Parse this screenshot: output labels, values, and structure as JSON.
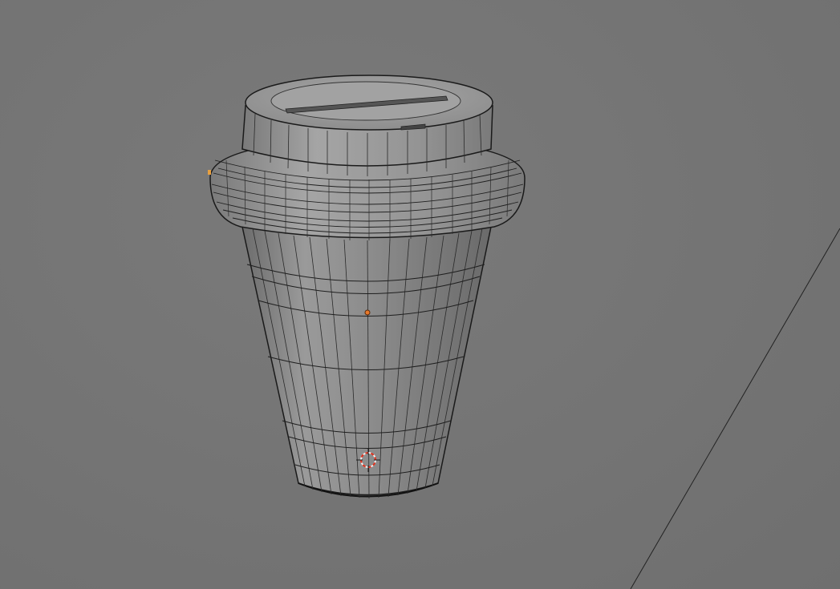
{
  "viewport": {
    "mode": "3d-viewport",
    "shading": "solid-wireframe",
    "background_color": "#767676",
    "wire_color": "#1e1e1e",
    "surface_color": "#8c8c8c",
    "origin_color": "#e8782a",
    "cursor_color": "#e0321e"
  },
  "scene": {
    "object_name": "coffee-cup",
    "has_3d_cursor": true,
    "has_object_origin": true,
    "has_floor_edge_line": true
  }
}
